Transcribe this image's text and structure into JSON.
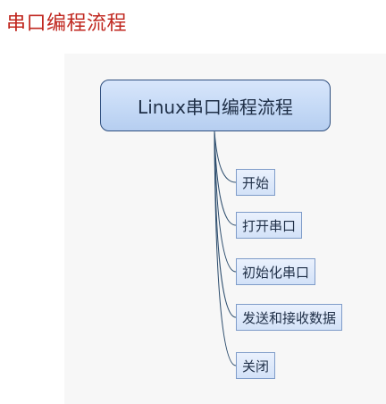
{
  "heading": "串口编程流程",
  "diagram": {
    "root": "Linux串口编程流程",
    "children": [
      "开始",
      "打开串口",
      "初始化串口",
      "发送和接收数据",
      "关闭"
    ]
  }
}
